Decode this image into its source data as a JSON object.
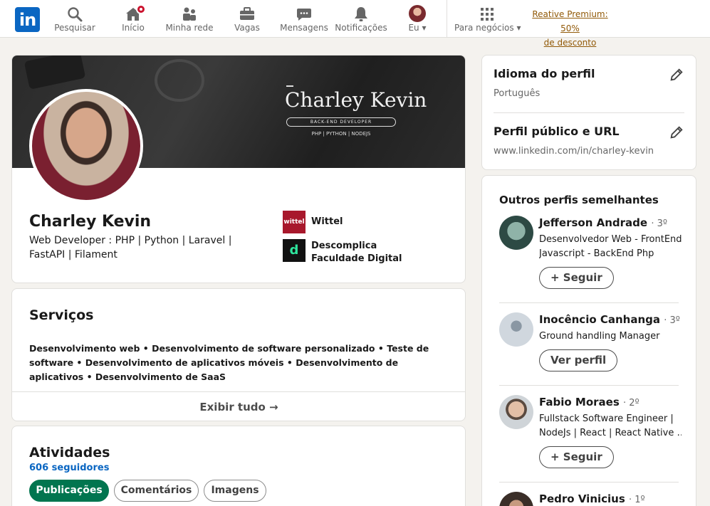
{
  "nav": {
    "logo": "in",
    "items": [
      {
        "label": "Pesquisar"
      },
      {
        "label": "Início"
      },
      {
        "label": "Minha rede"
      },
      {
        "label": "Vagas"
      },
      {
        "label": "Mensagens"
      },
      {
        "label": "Notificações"
      },
      {
        "label": "Eu"
      },
      {
        "label": "Para negócios"
      }
    ],
    "premium_line1": "Reative Premium: 50%",
    "premium_line2": "de desconto"
  },
  "profile": {
    "banner_name": "Charley Kevin",
    "banner_role": "BACK-END DEVELOPER",
    "banner_stack": "PHP  |  PYTHON  |  NODEJS",
    "name": "Charley Kevin",
    "headline": "Web Developer : PHP | Python | Laravel | FastAPI | Filament",
    "companies": [
      {
        "name": "Wittel",
        "logo_text": "wittel"
      },
      {
        "name": "Descomplica Faculdade Digital",
        "logo_text": "d"
      }
    ]
  },
  "services": {
    "title": "Serviços",
    "text": "Desenvolvimento web • Desenvolvimento de software personalizado • Teste de software • Desenvolvimento de aplicativos móveis • Desenvolvimento de aplicativos • Desenvolvimento de SaaS",
    "show_all": "Exibir tudo →"
  },
  "activities": {
    "title": "Atividades",
    "followers": "606 seguidores",
    "tabs": [
      "Publicações",
      "Comentários",
      "Imagens"
    ]
  },
  "sidebar": {
    "language_title": "Idioma do perfil",
    "language_value": "Português",
    "url_title": "Perfil público e URL",
    "url_value": "www.linkedin.com/in/charley-kevin",
    "similar_title": "Outros perfis semelhantes",
    "people": [
      {
        "name": "Jefferson Andrade",
        "degree": "· 3º",
        "desc1": "Desenvolvedor Web - FrontEnd",
        "desc2": "Javascript - BackEnd Php",
        "button": "+ Seguir"
      },
      {
        "name": "Inocêncio Canhanga",
        "degree": "· 3º",
        "desc1": "Ground handling Manager",
        "desc2": "",
        "button": "Ver perfil"
      },
      {
        "name": "Fabio Moraes",
        "degree": "· 2º",
        "desc1": "Fullstack Software Engineer |",
        "desc2": "NodeJs | React | React Native …",
        "button": "+ Seguir"
      },
      {
        "name": "Pedro Vinicius",
        "degree": "· 1º",
        "desc1": "",
        "desc2": "",
        "button": ""
      }
    ]
  },
  "colors": {
    "brand": "#0a66c2",
    "active_pill": "#01754f",
    "notification_badge": "#cb112d",
    "premium_link": "#915907"
  }
}
